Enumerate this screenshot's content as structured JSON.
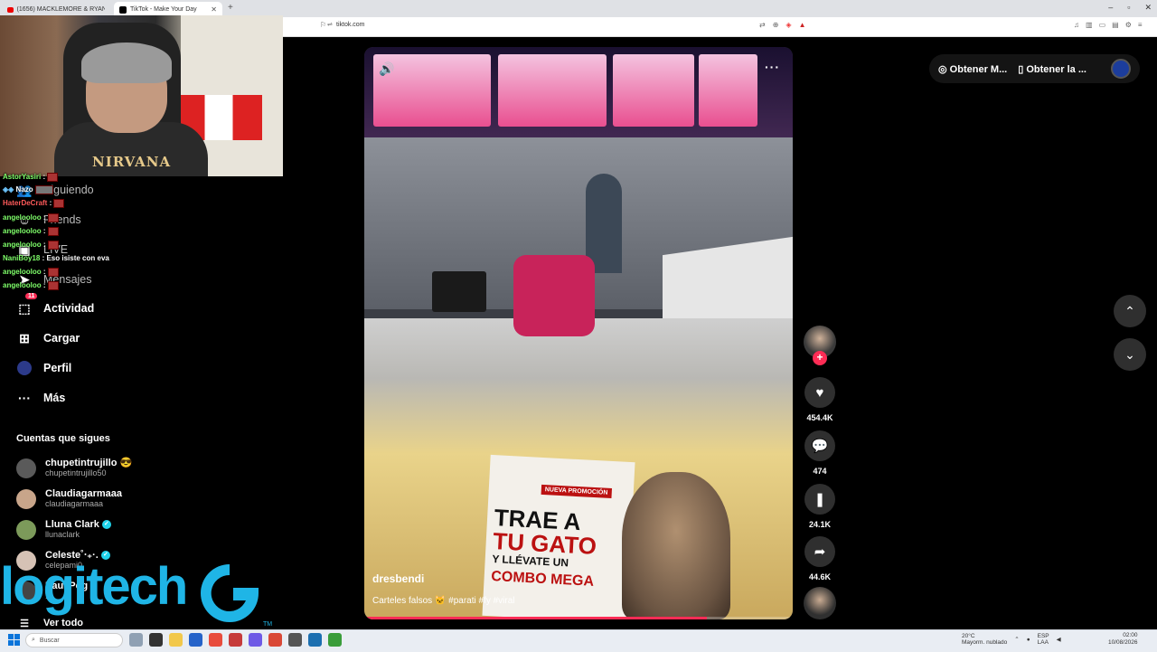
{
  "browser": {
    "tabs": [
      {
        "title": "(1656) MACKLEMORE & RYAN LEWI"
      },
      {
        "title": "TikTok - Make Your Day"
      }
    ],
    "url": "tiktok.com"
  },
  "webcam": {
    "shirt_text": "NIRVANA"
  },
  "sidebar": {
    "items": [
      {
        "label": "Siguiendo",
        "icon": "people-icon"
      },
      {
        "label": "Friends",
        "icon": "friends-icon"
      },
      {
        "label": "LIVE",
        "icon": "live-icon"
      },
      {
        "label": "Mensajes",
        "icon": "send-icon"
      },
      {
        "label": "Actividad",
        "icon": "inbox-icon",
        "badge": "11"
      },
      {
        "label": "Cargar",
        "icon": "plus-square-icon"
      },
      {
        "label": "Perfil",
        "icon": "avatar-icon"
      },
      {
        "label": "Más",
        "icon": "more-icon"
      }
    ],
    "following_title": "Cuentas que sigues",
    "accounts": [
      {
        "name": "chupetintrujillo 😎",
        "handle": "chupetintrujillo50"
      },
      {
        "name": "Claudiagarmaaa",
        "handle": "claudiagarmaaa"
      },
      {
        "name": "Lluna Clark",
        "handle": "llunaclark",
        "verified": true
      },
      {
        "name": "Celeste˚‧₊·.",
        "handle": "celepami0",
        "verified": true
      },
      {
        "name": "Paul Pog",
        "handle": "..."
      }
    ],
    "see_more": "Ver todo"
  },
  "chat": [
    {
      "user": "AstorYasiri",
      "msg": "",
      "color": "green"
    },
    {
      "user": "",
      "msg": "Nazo",
      "color": "blue"
    },
    {
      "user": "HaterDeCraft",
      "msg": "",
      "color": "red"
    },
    {
      "user": "angelooloo",
      "msg": "",
      "color": "green"
    },
    {
      "user": "angelooloo",
      "msg": "",
      "color": "green"
    },
    {
      "user": "angelooloo",
      "msg": "",
      "color": "green"
    },
    {
      "user": "NaniBoy18",
      "msg": "Eso isiste con eva",
      "color": "green"
    },
    {
      "user": "angelooloo",
      "msg": "",
      "color": "green"
    },
    {
      "user": "angelooloo",
      "msg": "",
      "color": "green"
    }
  ],
  "overlay": {
    "brand": "logitech",
    "tm": "TM"
  },
  "video": {
    "author": "dresbendi",
    "description": "Carteles falsos 🐱 #parati #fy #viral",
    "sign_lines": [
      "TRAE A",
      "TU GATO",
      "Y LLÉVATE UN",
      "COMBO MEGA"
    ],
    "sign_tag": "NUEVA PROMOCIÓN",
    "progress": 0.8
  },
  "actions": {
    "likes": "454.4K",
    "comments": "474",
    "saves": "24.1K",
    "shares": "44.6K"
  },
  "topbar": {
    "get_coins": "Obtener M...",
    "get_app": "Obtener la ..."
  },
  "taskbar": {
    "search_placeholder": "Buscar",
    "weather": "20°C",
    "weather_desc": "Mayorm. nublado",
    "lang": "ESP",
    "lang2": "LAA",
    "time": "02:00",
    "date": "10/08/2026"
  }
}
